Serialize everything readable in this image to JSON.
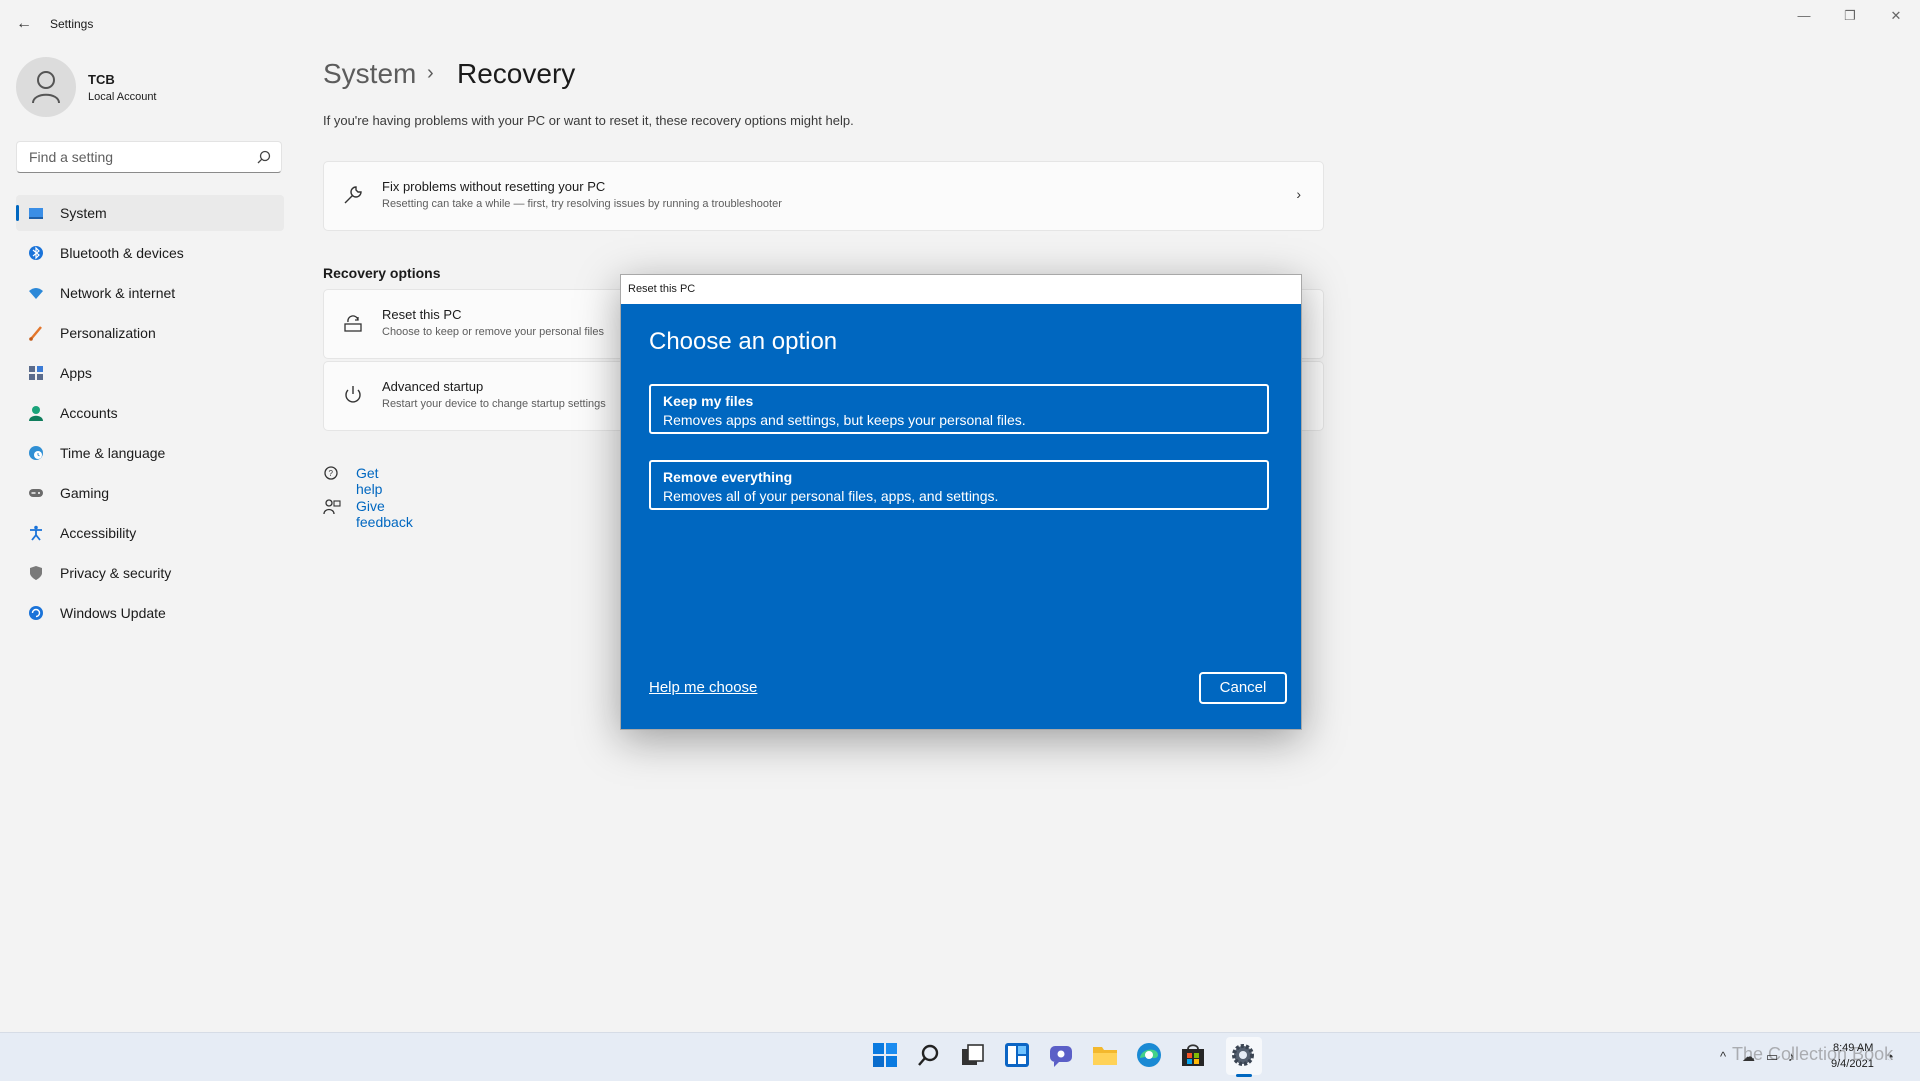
{
  "window": {
    "title": "Settings"
  },
  "user": {
    "name": "TCB",
    "account_type": "Local Account"
  },
  "search": {
    "placeholder": "Find a setting"
  },
  "sidebar": {
    "items": [
      {
        "label": "System",
        "icon": "system-icon",
        "active": true
      },
      {
        "label": "Bluetooth & devices",
        "icon": "bluetooth-icon"
      },
      {
        "label": "Network & internet",
        "icon": "wifi-icon"
      },
      {
        "label": "Personalization",
        "icon": "brush-icon"
      },
      {
        "label": "Apps",
        "icon": "apps-icon"
      },
      {
        "label": "Accounts",
        "icon": "person-icon"
      },
      {
        "label": "Time & language",
        "icon": "globe-clock-icon"
      },
      {
        "label": "Gaming",
        "icon": "gamepad-icon"
      },
      {
        "label": "Accessibility",
        "icon": "accessibility-icon"
      },
      {
        "label": "Privacy & security",
        "icon": "shield-icon"
      },
      {
        "label": "Windows Update",
        "icon": "update-icon"
      }
    ]
  },
  "breadcrumb": {
    "parent": "System",
    "separator": "›",
    "current": "Recovery"
  },
  "intro_text": "If you're having problems with your PC or want to reset it, these recovery options might help.",
  "fix_card": {
    "title": "Fix problems without resetting your PC",
    "subtitle": "Resetting can take a while — first, try resolving issues by running a troubleshooter"
  },
  "recovery_options": {
    "heading": "Recovery options",
    "reset": {
      "title": "Reset this PC",
      "subtitle": "Choose to keep or remove your personal files"
    },
    "advanced": {
      "title": "Advanced startup",
      "subtitle": "Restart your device to change startup settings"
    }
  },
  "links": {
    "get_help": "Get help",
    "give_feedback": "Give feedback"
  },
  "dialog": {
    "title": "Reset this PC",
    "heading": "Choose an option",
    "options": [
      {
        "title": "Keep my files",
        "subtitle": "Removes apps and settings, but keeps your personal files."
      },
      {
        "title": "Remove everything",
        "subtitle": "Removes all of your personal files, apps, and settings."
      }
    ],
    "help_link": "Help me choose",
    "cancel_label": "Cancel"
  },
  "taskbar": {
    "icons": [
      "start-icon",
      "search-icon",
      "task-view-icon",
      "widgets-icon",
      "chat-icon",
      "file-explorer-icon",
      "edge-icon",
      "store-icon",
      "settings-icon"
    ],
    "time": "8:49 AM",
    "date": "9/4/2021",
    "watermark": "The Collection Book"
  },
  "colors": {
    "accent": "#0067c0",
    "background": "#f3f3f3",
    "dialog": "#0067c0"
  }
}
